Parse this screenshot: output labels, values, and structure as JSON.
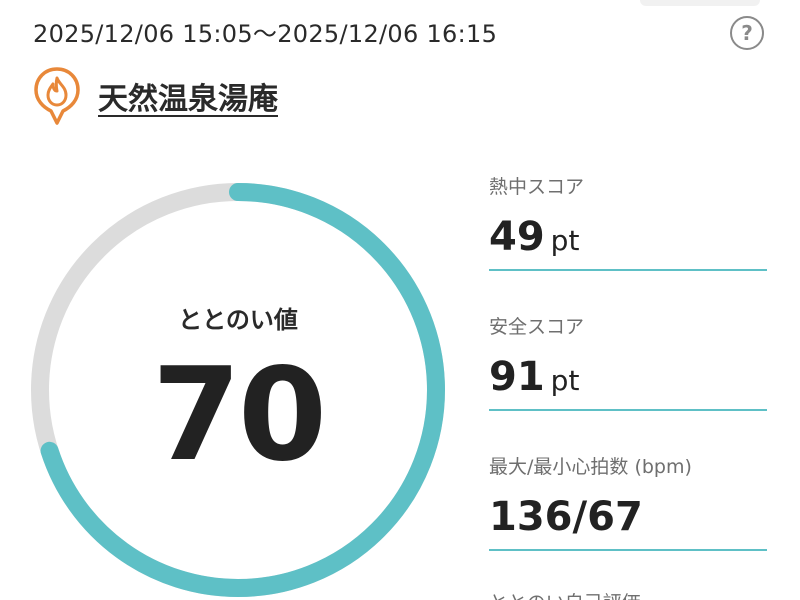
{
  "header": {
    "date_range": "2025/12/06 15:05～2025/12/06 16:15",
    "help_icon": "question-circle-icon"
  },
  "facility": {
    "name": "天然温泉湯庵",
    "icon": "flame-pin-icon"
  },
  "totonoi": {
    "label": "ととのい値",
    "value": "70",
    "progress": 0.7
  },
  "metrics": [
    {
      "label": "熱中スコア",
      "value": "49",
      "unit": "pt"
    },
    {
      "label": "安全スコア",
      "value": "91",
      "unit": "pt"
    },
    {
      "label": "最大/最小心拍数 (bpm)",
      "value": "136/67",
      "unit": ""
    }
  ],
  "next_label_partial": "ととのい自己評価",
  "colors": {
    "accent": "#5ec0c6",
    "track": "#dcdcdc",
    "icon_orange": "#e8883a"
  }
}
